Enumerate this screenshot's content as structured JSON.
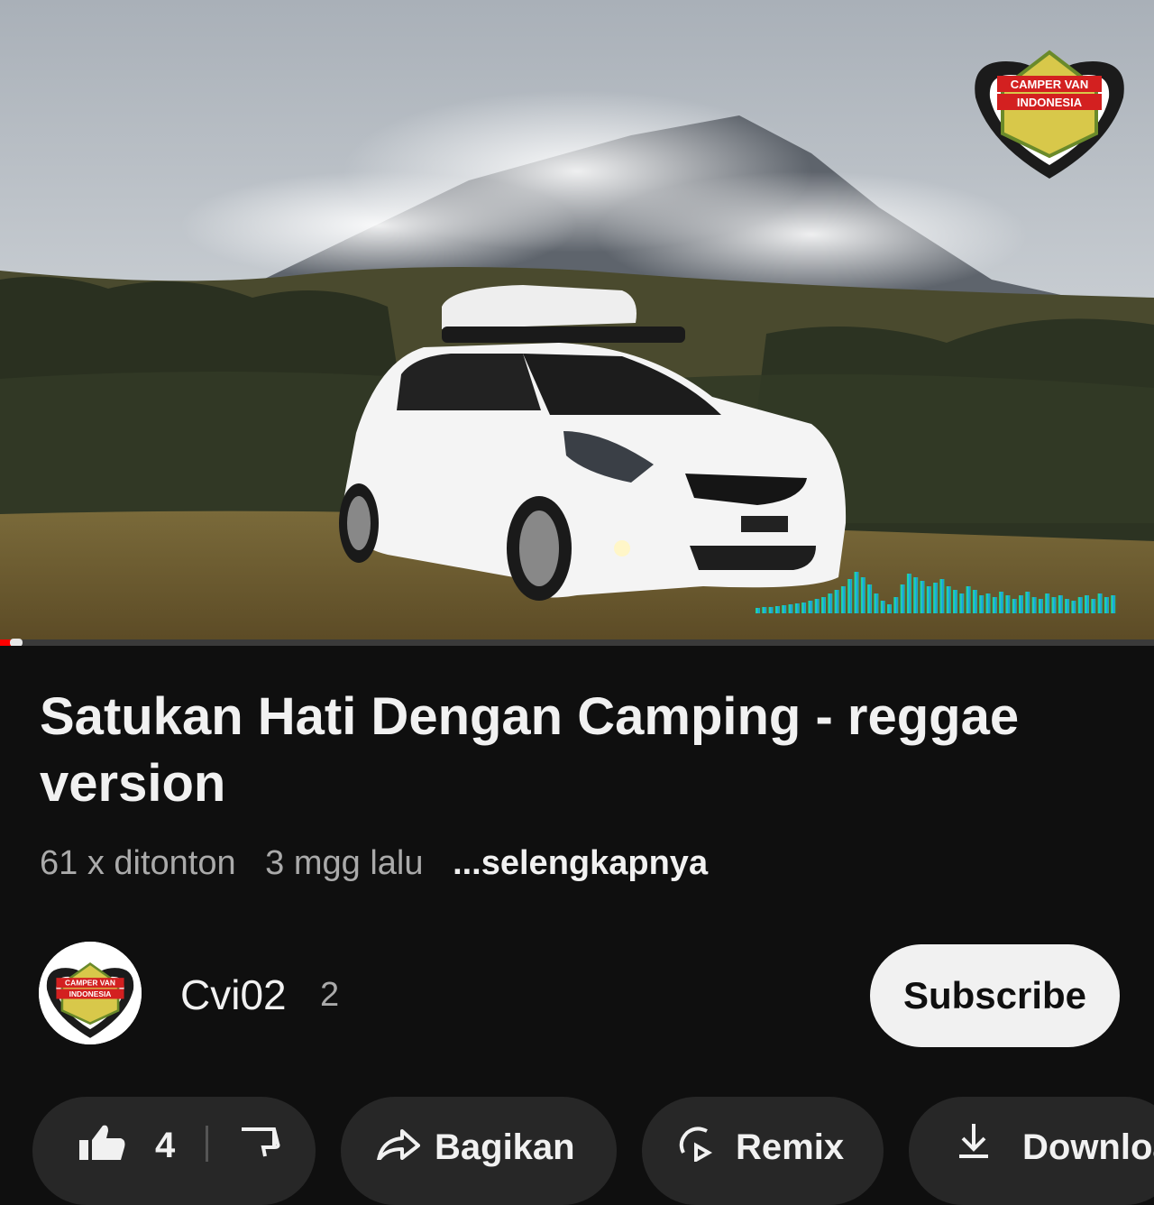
{
  "video": {
    "logo_text_top": "CAMPER VAN",
    "logo_text_bottom": "INDONESIA",
    "progress_fraction": 0.01
  },
  "info": {
    "title": "Satukan Hati Dengan Camping - reggae version",
    "views": "61 x ditonton",
    "age": "3 mgg lalu",
    "more": "...selengkapnya"
  },
  "channel": {
    "name": "Cvi02",
    "subscribers": "2",
    "subscribe_label": "Subscribe"
  },
  "actions": {
    "like_count": "4",
    "share_label": "Bagikan",
    "remix_label": "Remix",
    "download_label": "Download"
  },
  "colors": {
    "background": "#0f0f0f",
    "chip": "#272727",
    "progress": "#ff0000",
    "subscribe_bg": "#f1f1f1"
  }
}
